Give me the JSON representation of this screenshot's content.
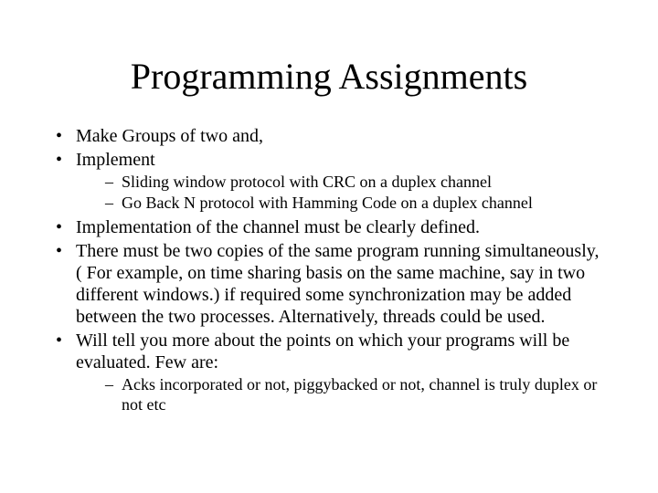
{
  "title": "Programming Assignments",
  "items": [
    {
      "text": "Make Groups of two and,"
    },
    {
      "text": "Implement",
      "sub": [
        "Sliding window protocol with CRC on a duplex channel",
        "Go Back N protocol with Hamming Code on a duplex channel"
      ]
    },
    {
      "text": "Implementation of the channel must be clearly defined."
    },
    {
      "text": "There must be two copies of the same program running simultaneously, ( For example, on time sharing basis on the same machine, say in two different windows.) if required some synchronization may be added between the two processes. Alternatively, threads could be used."
    },
    {
      "text": "Will tell you more about the points on which your programs will be evaluated. Few are:",
      "sub": [
        "Acks incorporated or not, piggybacked or not, channel is truly duplex or not etc"
      ]
    }
  ]
}
